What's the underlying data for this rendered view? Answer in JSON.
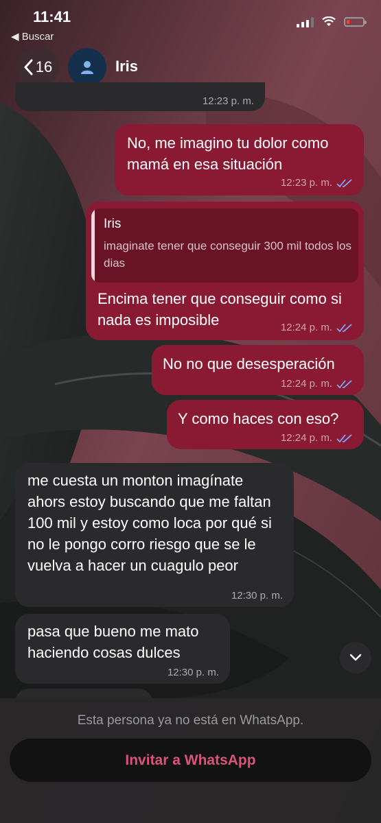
{
  "status_bar": {
    "time": "11:41",
    "back_app": "◀ Buscar"
  },
  "header": {
    "back_count": "16",
    "contact_name": "Iris"
  },
  "messages": [
    {
      "dir": "in",
      "text": "",
      "time": "12:23 p. m."
    },
    {
      "dir": "out",
      "text": "No, me imagino tu dolor como mamá en esa situación",
      "time": "12:23 p. m."
    },
    {
      "dir": "out",
      "quote": {
        "name": "Iris",
        "text": "imaginate tener que conseguir 300 mil todos los dias"
      },
      "text": "Encima tener que conseguir como si nada es imposible",
      "time": "12:24 p. m."
    },
    {
      "dir": "out",
      "text": "No no que desesperación",
      "time": "12:24 p. m."
    },
    {
      "dir": "out",
      "text": "Y como haces con eso?",
      "time": "12:24 p. m."
    },
    {
      "dir": "in",
      "text": "me cuesta un monton imagínate ahors estoy buscando que me faltan 100 mil y estoy como loca por qué si no le pongo corro riesgo que se le vuelva a hacer un cuagulo peor",
      "time": "12:30 p. m."
    },
    {
      "dir": "in",
      "text": "pasa que bueno me mato haciendo cosas dulces",
      "time": "12:30 p. m."
    }
  ],
  "footer": {
    "note": "Esta persona ya no está en WhatsApp.",
    "invite_label": "Invitar a WhatsApp"
  },
  "colors": {
    "outgoing": "#8a1a33",
    "incoming": "#2a2a2c",
    "accent": "#d9537a",
    "read_ticks": "#7aa7ff"
  },
  "icons": [
    "back-chevron-icon",
    "contact-avatar-icon",
    "signal-icon",
    "wifi-icon",
    "battery-icon",
    "double-check-icon",
    "chevron-down-icon"
  ]
}
